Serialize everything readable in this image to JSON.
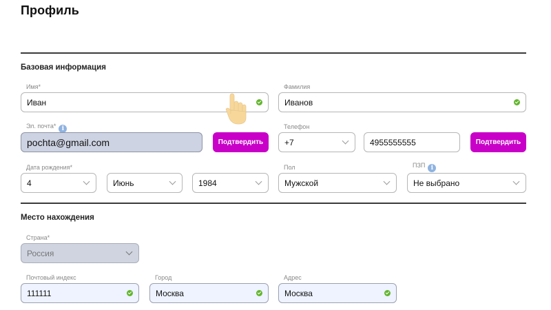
{
  "page": {
    "title": "Профиль"
  },
  "basic": {
    "section_title": "Базовая информация",
    "first_name": {
      "label": "Имя",
      "required": "*",
      "value": "Иван"
    },
    "last_name": {
      "label": "Фамилия",
      "value": "Иванов"
    },
    "email": {
      "label": "Эл. почта",
      "required": "*",
      "value": "pochta@gmail.com",
      "confirm_label": "Подтвердить"
    },
    "phone": {
      "label": "Телефон",
      "code": "+7",
      "number": "4955555555",
      "confirm_label": "Подтвердить"
    },
    "birth": {
      "label": "Дата рождения",
      "required": "*",
      "day": "4",
      "month": "Июнь",
      "year": "1984"
    },
    "gender": {
      "label": "Пол",
      "value": "Мужской"
    },
    "pzp": {
      "label": "ПЗП",
      "value": "Не выбрано"
    }
  },
  "location": {
    "section_title": "Место нахождения",
    "country": {
      "label": "Страна",
      "required": "*",
      "value": "Россия"
    },
    "postal": {
      "label": "Почтовый индекс",
      "value": "111111"
    },
    "city": {
      "label": "Город",
      "value": "Москва"
    },
    "address": {
      "label": "Адрес",
      "value": "Москва"
    }
  },
  "colors": {
    "accent": "#c800c8",
    "valid": "#62b52d",
    "info": "#8fb3e0"
  },
  "icons": [
    "check-icon",
    "chevron-down-icon",
    "info-icon",
    "hand-cursor-icon"
  ]
}
